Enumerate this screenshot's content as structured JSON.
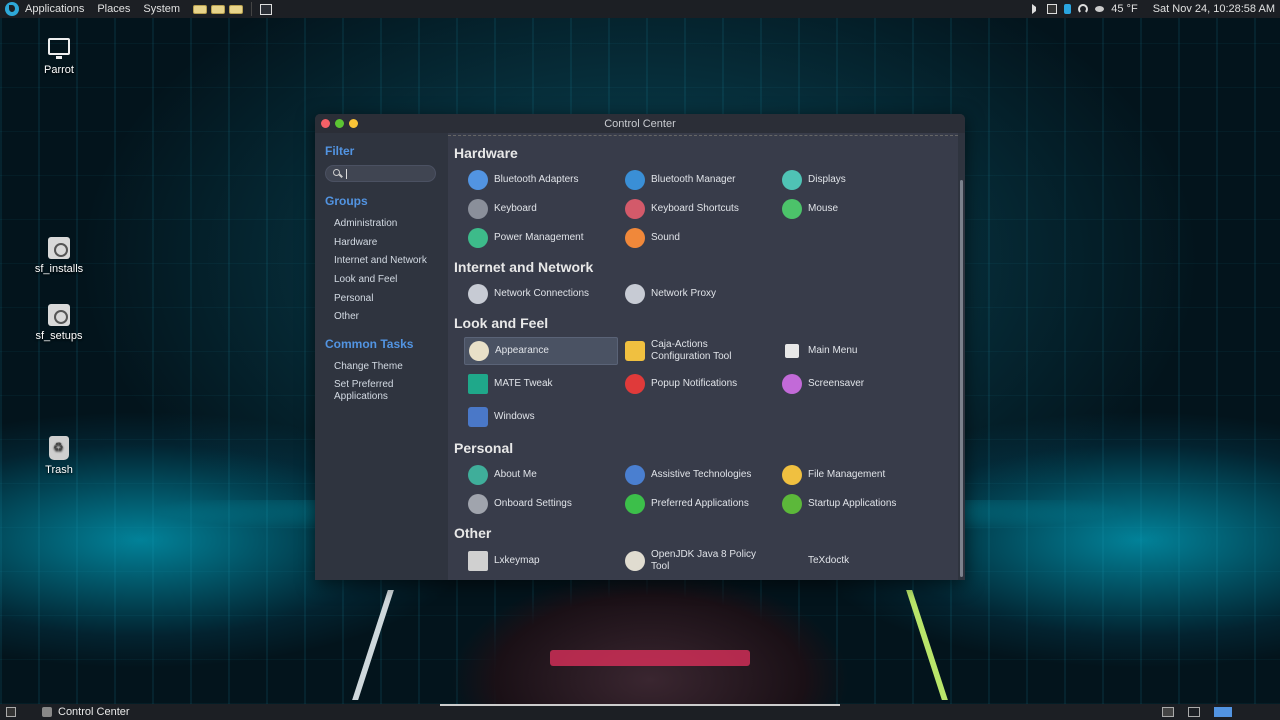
{
  "top_panel": {
    "menus": [
      "Applications",
      "Places",
      "System"
    ],
    "tray": {
      "temperature": "45 °F",
      "clock": "Sat Nov 24, 10:28:58 AM"
    }
  },
  "desktop_icons": [
    {
      "label": "Parrot",
      "icon": "monitor-icon"
    },
    {
      "label": "sf_installs",
      "icon": "disk-icon"
    },
    {
      "label": "sf_setups",
      "icon": "disk-icon"
    },
    {
      "label": "Trash",
      "icon": "trash-icon"
    }
  ],
  "window": {
    "title": "Control Center",
    "sidebar": {
      "filter_heading": "Filter",
      "search_value": "",
      "groups_heading": "Groups",
      "groups": [
        "Administration",
        "Hardware",
        "Internet and Network",
        "Look and Feel",
        "Personal",
        "Other"
      ],
      "common_tasks_heading": "Common Tasks",
      "common_tasks": [
        "Change Theme",
        "Set Preferred Applications"
      ]
    },
    "categories": {
      "hardware": {
        "title": "Hardware",
        "items": [
          {
            "label": "Bluetooth Adapters",
            "icon": "bluetooth-adapter-icon",
            "color": "#5294e2"
          },
          {
            "label": "Bluetooth Manager",
            "icon": "bluetooth-icon",
            "color": "#3a8fd6"
          },
          {
            "label": "Displays",
            "icon": "display-icon",
            "color": "#4fc3b5"
          },
          {
            "label": "Keyboard",
            "icon": "keyboard-icon",
            "color": "#8a8f9a"
          },
          {
            "label": "Keyboard Shortcuts",
            "icon": "keyboard-shortcuts-icon",
            "color": "#d35a6a"
          },
          {
            "label": "Mouse",
            "icon": "mouse-icon",
            "color": "#4cc36a"
          },
          {
            "label": "Power Management",
            "icon": "power-management-icon",
            "color": "#3dbb8a"
          },
          {
            "label": "Sound",
            "icon": "sound-icon",
            "color": "#f0883a"
          }
        ]
      },
      "internet": {
        "title": "Internet and Network",
        "items": [
          {
            "label": "Network Connections",
            "icon": "network-connections-icon",
            "color": "#c7cbd4"
          },
          {
            "label": "Network Proxy",
            "icon": "network-proxy-icon",
            "color": "#c7cbd4"
          }
        ]
      },
      "look": {
        "title": "Look and Feel",
        "items": [
          {
            "label": "Appearance",
            "icon": "appearance-icon",
            "color": "#e8e0c8"
          },
          {
            "label": "Caja-Actions Configuration Tool",
            "label_line1": "Caja-Actions",
            "label_line2": "Configuration Tool",
            "icon": "caja-actions-icon",
            "color": "#f0c040"
          },
          {
            "label": "Main Menu",
            "icon": "main-menu-icon",
            "color": "#e04050"
          },
          {
            "label": "MATE Tweak",
            "icon": "mate-tweak-icon",
            "color": "#1fa88a"
          },
          {
            "label": "Popup Notifications",
            "icon": "popup-notifications-icon",
            "color": "#e03a3a"
          },
          {
            "label": "Screensaver",
            "icon": "screensaver-icon",
            "color": "#c26ad8"
          },
          {
            "label": "Windows",
            "icon": "windows-icon",
            "color": "#4a78c8"
          }
        ]
      },
      "personal": {
        "title": "Personal",
        "items": [
          {
            "label": "About Me",
            "icon": "about-me-icon",
            "color": "#3fae9a"
          },
          {
            "label": "Assistive Technologies",
            "icon": "assistive-technologies-icon",
            "color": "#4a7fd0"
          },
          {
            "label": "File Management",
            "icon": "file-management-icon",
            "color": "#f0c040"
          },
          {
            "label": "Onboard Settings",
            "icon": "onboard-settings-icon",
            "color": "#a0a4ad"
          },
          {
            "label": "Preferred Applications",
            "icon": "preferred-applications-icon",
            "color": "#3cbf4a"
          },
          {
            "label": "Startup Applications",
            "icon": "startup-applications-icon",
            "color": "#5cb83a"
          }
        ]
      },
      "other": {
        "title": "Other",
        "items": [
          {
            "label": "Lxkeymap",
            "icon": "lxkeymap-icon",
            "color": "#d0d0d0"
          },
          {
            "label": "OpenJDK Java 8 Policy Tool",
            "label_line1": "OpenJDK Java 8 Policy",
            "label_line2": "Tool",
            "icon": "java-policy-icon",
            "color": "#e0dcd0"
          },
          {
            "label": "TeXdoctk",
            "icon": "texdoctk-icon",
            "color": ""
          }
        ]
      }
    }
  },
  "bottom_panel": {
    "task_label": "Control Center"
  }
}
